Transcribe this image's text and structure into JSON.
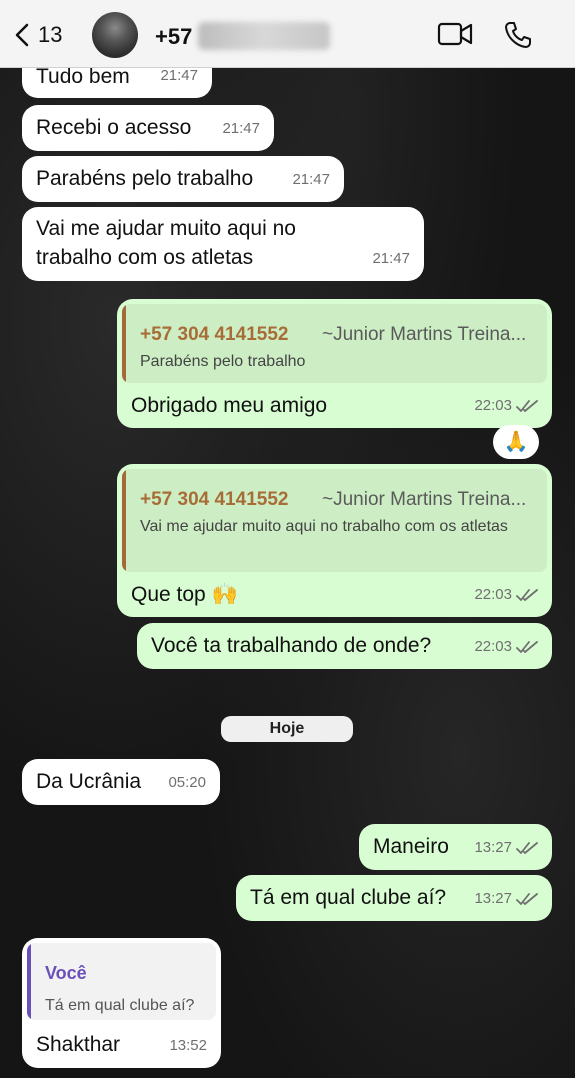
{
  "header": {
    "unread_count": "13",
    "contact_prefix": "+57",
    "video_icon": "video-camera-icon",
    "phone_icon": "phone-icon"
  },
  "messages": [
    {
      "text": "Tudo bem",
      "time": "21:47",
      "direction": "incoming"
    },
    {
      "text": "Recebi o acesso",
      "time": "21:47",
      "direction": "incoming"
    },
    {
      "text": "Parabéns pelo trabalho",
      "time": "21:47",
      "direction": "incoming"
    },
    {
      "text": "Vai me ajudar muito aqui no trabalho com os atletas",
      "time": "21:47",
      "direction": "incoming"
    },
    {
      "text": "Obrigado meu amigo",
      "time": "22:03",
      "direction": "outgoing",
      "quote": {
        "sender": "+57 304 4141552",
        "sender_name": "~Junior Martins Treina...",
        "text": "Parabéns pelo trabalho"
      },
      "reaction": "🙏"
    },
    {
      "text": "Que top 🙌",
      "time": "22:03",
      "direction": "outgoing",
      "quote": {
        "sender": "+57 304 4141552",
        "sender_name": "~Junior Martins Treina...",
        "text": "Vai me ajudar muito aqui no trabalho com os atletas"
      }
    },
    {
      "text": "Você ta trabalhando de onde?",
      "time": "22:03",
      "direction": "outgoing"
    },
    {
      "text": "Da Ucrânia",
      "time": "05:20",
      "direction": "incoming"
    },
    {
      "text": "Maneiro",
      "time": "13:27",
      "direction": "outgoing"
    },
    {
      "text": "Tá em qual clube aí?",
      "time": "13:27",
      "direction": "outgoing"
    },
    {
      "text": "Shakthar",
      "time": "13:52",
      "direction": "incoming",
      "quote": {
        "sender": "Você",
        "text": "Tá em qual clube aí?"
      }
    }
  ],
  "date_separator": "Hoje",
  "colors": {
    "incoming_bubble": "#ffffff",
    "outgoing_bubble": "#d9fdd3",
    "quote_accent": "#a5683a",
    "self_quote_accent": "#6b4fbb"
  }
}
